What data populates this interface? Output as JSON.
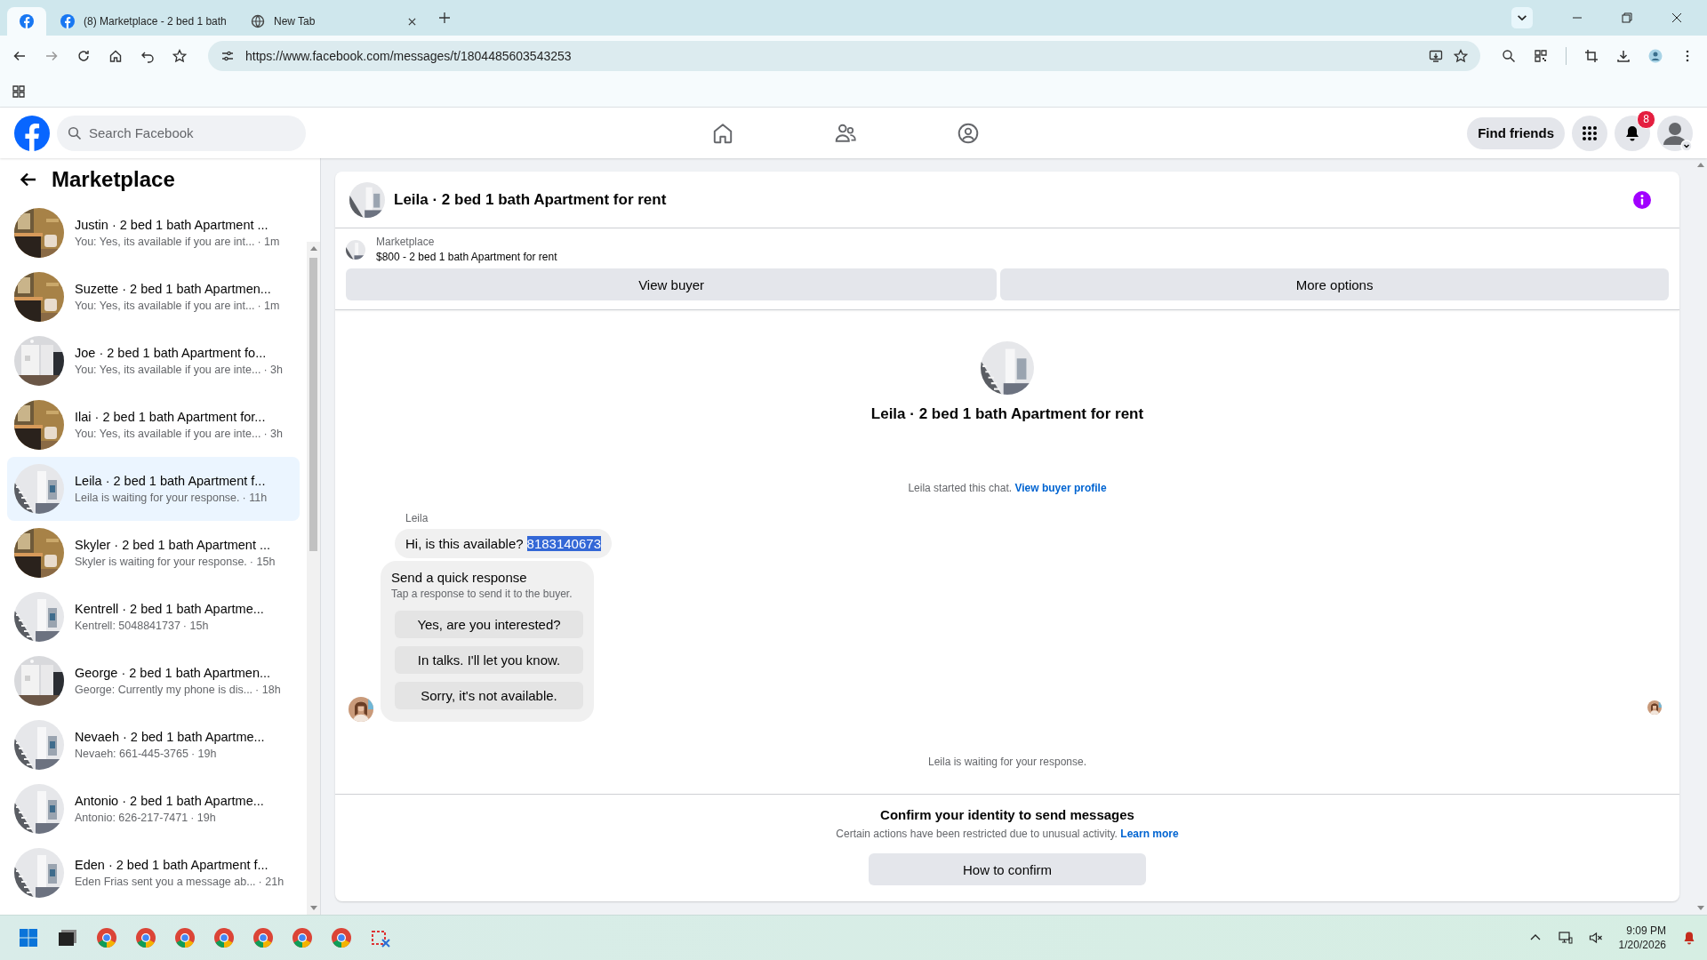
{
  "browser": {
    "tabs": [
      {
        "kind": "pinned",
        "selected": true
      },
      {
        "kind": "page",
        "title": "(8) Marketplace - 2 bed 1 bath",
        "selected": false
      },
      {
        "kind": "page",
        "title": "New Tab",
        "selected": false
      }
    ],
    "url": "https://www.facebook.com/messages/t/1804485603543253"
  },
  "header": {
    "search_placeholder": "Search Facebook",
    "find_friends": "Find friends",
    "notification_count": "8"
  },
  "sidebar": {
    "title": "Marketplace",
    "conversations": [
      {
        "title": "Justin · 2 bed 1 bath Apartment ...",
        "preview": "You: Yes, its available if you are int...",
        "time": "· 1m",
        "selected": false
      },
      {
        "title": "Suzette · 2 bed 1 bath Apartmen...",
        "preview": "You: Yes, its available if you are int...",
        "time": "· 1m",
        "selected": false
      },
      {
        "title": "Joe · 2 bed 1 bath Apartment fo...",
        "preview": "You: Yes, its available if you are inte...",
        "time": "· 3h",
        "selected": false
      },
      {
        "title": "Ilai · 2 bed 1 bath Apartment for...",
        "preview": "You: Yes, its available if you are inte...",
        "time": "· 3h",
        "selected": false
      },
      {
        "title": "Leila · 2 bed 1 bath Apartment f...",
        "preview": "Leila is waiting for your response.",
        "time": "· 11h",
        "selected": true
      },
      {
        "title": "Skyler · 2 bed 1 bath Apartment ...",
        "preview": "Skyler is waiting for your response.",
        "time": "· 15h",
        "selected": false
      },
      {
        "title": "Kentrell · 2 bed 1 bath Apartme...",
        "preview": "Kentrell: 5048841737",
        "time": "· 15h",
        "selected": false
      },
      {
        "title": "George · 2 bed 1 bath Apartmen...",
        "preview": "George: Currently my phone is dis...",
        "time": "· 18h",
        "selected": false
      },
      {
        "title": "Nevaeh · 2 bed 1 bath Apartme...",
        "preview": "Nevaeh: 661-445-3765",
        "time": "· 19h",
        "selected": false
      },
      {
        "title": "Antonio · 2 bed 1 bath Apartme...",
        "preview": "Antonio: 626-217-7471",
        "time": "· 19h",
        "selected": false
      },
      {
        "title": "Eden · 2 bed 1 bath Apartment f...",
        "preview": "Eden Frias sent you a message ab...",
        "time": "· 21h",
        "selected": false
      }
    ]
  },
  "chat": {
    "title": "Leila · 2 bed 1 bath Apartment for rent",
    "listing": {
      "label": "Marketplace",
      "text": "$800 - 2 bed 1 bath Apartment for rent"
    },
    "buttons": [
      "View buyer",
      "More options"
    ],
    "intro_title": "Leila · 2 bed 1 bath Apartment for rent",
    "started_text": "Leila started this chat.",
    "started_link": "View buyer profile",
    "sender": "Leila",
    "message_parts": [
      {
        "text": "Hi, is this available?",
        "selected": false
      },
      {
        "text": "8183140673",
        "selected": true
      }
    ],
    "quick_response": {
      "title": "Send a quick response",
      "subtitle": "Tap a response to send it to the buyer.",
      "options": [
        "Yes, are you interested?",
        "In talks. I'll let you know.",
        "Sorry, it's not available."
      ]
    },
    "status": "Leila is waiting for your response.",
    "restriction": {
      "title": "Confirm your identity to send messages",
      "text": "Certain actions have been restricted due to unusual activity.",
      "link": "Learn more",
      "button": "How to confirm"
    }
  },
  "taskbar": {
    "time": "9:09 PM",
    "date": "1/20/2026"
  }
}
